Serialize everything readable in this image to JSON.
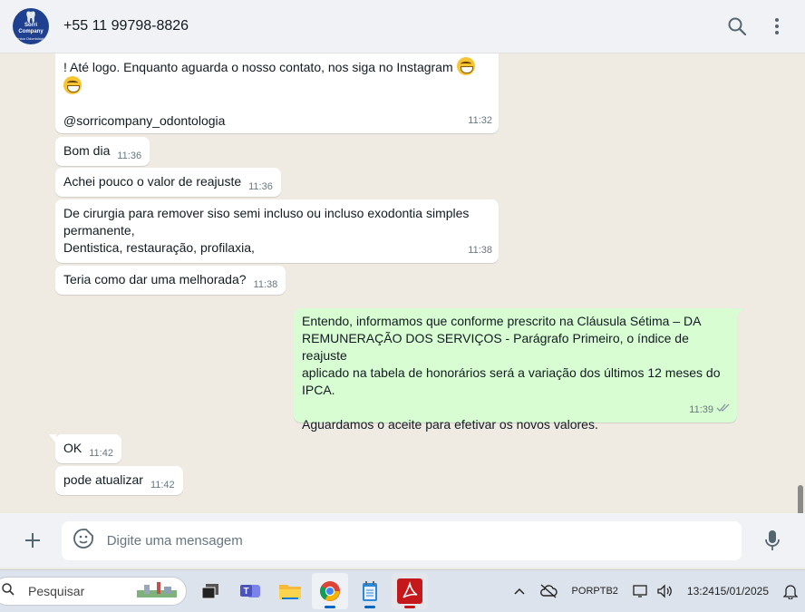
{
  "header": {
    "avatar_line1": "Sorri Company",
    "avatar_line2": "Clínica Odontológica",
    "contact_name": "+55 11 99798-8826",
    "icons": [
      "search-icon",
      "menu-dots-icon"
    ]
  },
  "messages": [
    {
      "id": "m1",
      "direction": "in",
      "line1": "! Até logo. Enquanto aguarda o nosso contato, nos siga no Instagram",
      "handle": "@sorricompany_odontologia",
      "time": "11:32"
    },
    {
      "id": "m2",
      "direction": "in",
      "text": "Bom dia",
      "time": "11:36"
    },
    {
      "id": "m3",
      "direction": "in",
      "text": "Achei pouco o valor de reajuste",
      "time": "11:36"
    },
    {
      "id": "m4",
      "direction": "in",
      "lines": [
        "De cirurgia para remover siso semi incluso ou incluso exodontia simples",
        "permanente,",
        "Dentistica, restauração, profilaxia,"
      ],
      "time": "11:38"
    },
    {
      "id": "m5",
      "direction": "in",
      "text": "Teria como dar uma melhorada?",
      "time": "11:38"
    },
    {
      "id": "m6",
      "direction": "out",
      "lines": [
        "Entendo, informamos que conforme prescrito na Cláusula Sétima – DA",
        "REMUNERAÇÃO DOS SERVIÇOS - Parágrafo Primeiro, o índice de reajuste",
        "aplicado na tabela de honorários será a variação dos últimos 12 meses do",
        "IPCA."
      ],
      "line_after": "Aguardamos o aceite para efetivar os novos valores.",
      "time": "11:39",
      "status": "read"
    },
    {
      "id": "m7",
      "direction": "in",
      "text": "OK",
      "time": "11:42"
    },
    {
      "id": "m8",
      "direction": "in",
      "text": "pode atualizar",
      "time": "11:42"
    }
  ],
  "composer": {
    "placeholder": "Digite uma mensagem",
    "icons": [
      "plus-icon",
      "sticker-icon",
      "mic-icon"
    ]
  },
  "taskbar": {
    "search_label": "Pesquisar",
    "lang_line1": "POR",
    "lang_line2": "PTB2",
    "time": "13:24",
    "date": "15/01/2025",
    "colors": {
      "accent": "#0067c0",
      "outgoing_bubble": "#d9fdd3",
      "chat_bg": "#efeae2"
    }
  }
}
